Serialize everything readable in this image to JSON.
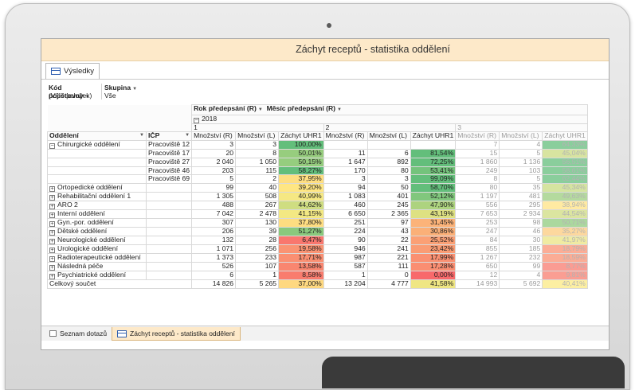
{
  "window_title": "Záchyt receptů - statistika oddělení",
  "results_tab": "Výsledky",
  "filters": {
    "headers": [
      "Kód pojišťovny",
      "Skupina"
    ],
    "values": [
      "(Více položek)",
      "Vše"
    ]
  },
  "pivot": {
    "column_fields": [
      "Rok předepsání (R)",
      "Měsíc předepsání (R)"
    ],
    "year": "2018",
    "months": [
      "1",
      "2",
      "3"
    ],
    "row_header_1": "Oddělení",
    "row_header_2": "IČP",
    "measure_headers": [
      "Množství (R)",
      "Množství (L)",
      "Záchyt UHR1"
    ],
    "rows": [
      {
        "dept": "Chirurgické oddělení",
        "expand": "−",
        "icp": "Pracoviště 12",
        "m1": [
          "3",
          "3",
          "100,00%"
        ],
        "m2": [
          "",
          "",
          ""
        ],
        "m3": [
          "7",
          "4",
          "64,33%"
        ]
      },
      {
        "dept": "",
        "expand": "",
        "icp": "Pracoviště 17",
        "m1": [
          "20",
          "8",
          "50,01%"
        ],
        "m2": [
          "11",
          "6",
          "81,54%"
        ],
        "m3": [
          "15",
          "5",
          "45,04%"
        ]
      },
      {
        "dept": "",
        "expand": "",
        "icp": "Pracoviště 27",
        "m1": [
          "2 040",
          "1 050",
          "50,15%"
        ],
        "m2": [
          "1 647",
          "892",
          "72,25%"
        ],
        "m3": [
          "1 860",
          "1 136",
          "56,51%"
        ]
      },
      {
        "dept": "",
        "expand": "",
        "icp": "Pracoviště 46",
        "m1": [
          "203",
          "115",
          "58,27%"
        ],
        "m2": [
          "170",
          "80",
          "53,41%"
        ],
        "m3": [
          "249",
          "103",
          "58,61%"
        ]
      },
      {
        "dept": "",
        "expand": "",
        "icp": "Pracoviště 69",
        "m1": [
          "5",
          "2",
          "37,95%"
        ],
        "m2": [
          "3",
          "3",
          "99,09%"
        ],
        "m3": [
          "8",
          "5",
          "62,44%"
        ]
      },
      {
        "dept": "Ortopedické oddělení",
        "expand": "+",
        "icp": "",
        "m1": [
          "99",
          "40",
          "39,20%"
        ],
        "m2": [
          "94",
          "50",
          "58,70%"
        ],
        "m3": [
          "80",
          "35",
          "45,34%"
        ]
      },
      {
        "dept": "Rehabilitační oddělení 1",
        "expand": "+",
        "icp": "",
        "m1": [
          "1 305",
          "508",
          "40,99%"
        ],
        "m2": [
          "1 083",
          "401",
          "52,12%"
        ],
        "m3": [
          "1 197",
          "481",
          "49,63%"
        ]
      },
      {
        "dept": "ARO 2",
        "expand": "+",
        "icp": "",
        "m1": [
          "488",
          "267",
          "44,62%"
        ],
        "m2": [
          "460",
          "245",
          "47,90%"
        ],
        "m3": [
          "556",
          "295",
          "38,94%"
        ]
      },
      {
        "dept": "Interní oddělení",
        "expand": "+",
        "icp": "",
        "m1": [
          "7 042",
          "2 478",
          "41,15%"
        ],
        "m2": [
          "6 650",
          "2 365",
          "43,19%"
        ],
        "m3": [
          "7 653",
          "2 934",
          "44,54%"
        ]
      },
      {
        "dept": "Gyn.-por. oddělení",
        "expand": "+",
        "icp": "",
        "m1": [
          "307",
          "130",
          "37,80%"
        ],
        "m2": [
          "251",
          "97",
          "31,45%"
        ],
        "m3": [
          "253",
          "98",
          "50,71%"
        ]
      },
      {
        "dept": "Dětské oddělení",
        "expand": "+",
        "icp": "",
        "m1": [
          "206",
          "39",
          "51,27%"
        ],
        "m2": [
          "224",
          "43",
          "30,86%"
        ],
        "m3": [
          "247",
          "46",
          "35,27%"
        ]
      },
      {
        "dept": "Neurologické oddělení",
        "expand": "+",
        "icp": "",
        "m1": [
          "132",
          "28",
          "6,47%"
        ],
        "m2": [
          "90",
          "22",
          "25,52%"
        ],
        "m3": [
          "84",
          "30",
          "41,97%"
        ]
      },
      {
        "dept": "Urologické oddělení",
        "expand": "+",
        "icp": "",
        "m1": [
          "1 071",
          "256",
          "19,58%"
        ],
        "m2": [
          "946",
          "241",
          "23,42%"
        ],
        "m3": [
          "855",
          "185",
          "18,79%"
        ]
      },
      {
        "dept": "Radioterapeutické oddělení",
        "expand": "+",
        "icp": "",
        "m1": [
          "1 373",
          "233",
          "17,71%"
        ],
        "m2": [
          "987",
          "221",
          "17,99%"
        ],
        "m3": [
          "1 267",
          "232",
          "18,59%"
        ]
      },
      {
        "dept": "Následná péče",
        "expand": "+",
        "icp": "",
        "m1": [
          "526",
          "107",
          "13,58%"
        ],
        "m2": [
          "587",
          "111",
          "17,28%"
        ],
        "m3": [
          "650",
          "99",
          "8,77%"
        ]
      },
      {
        "dept": "Psychiatrické oddělení",
        "expand": "+",
        "icp": "",
        "m1": [
          "6",
          "1",
          "8,58%"
        ],
        "m2": [
          "1",
          "0",
          "0,00%"
        ],
        "m3": [
          "12",
          "4",
          "9,81%"
        ]
      }
    ],
    "total": {
      "label": "Celkový součet",
      "m1": [
        "14 826",
        "5 265",
        "37,00%"
      ],
      "m2": [
        "13 204",
        "4 777",
        "41,58%"
      ],
      "m3": [
        "14 993",
        "5 692",
        "40,41%"
      ]
    }
  },
  "bottom_tabs": [
    "Seznam dotazů",
    "Záchyt receptů - statistika oddělení"
  ],
  "colors": {
    "title_bg": "#fde9c9",
    "good": "#63be7b",
    "mid": "#ffeb84",
    "bad": "#f8696b"
  }
}
